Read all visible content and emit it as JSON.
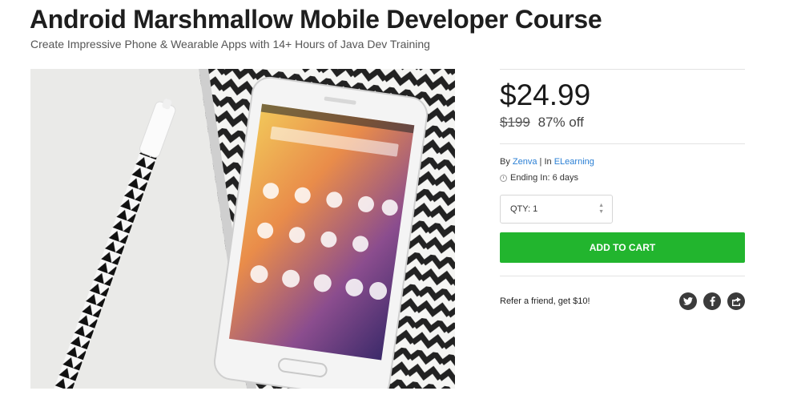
{
  "product": {
    "title": "Android Marshmallow Mobile Developer Course",
    "subtitle": "Create Impressive Phone & Wearable Apps with 14+ Hours of Java Dev Training"
  },
  "pricing": {
    "price": "$24.99",
    "original_price": "$199",
    "discount": "87% off"
  },
  "meta": {
    "by_label": "By",
    "vendor": "Zenva",
    "separator": "|",
    "in_label": "In",
    "category": "ELearning",
    "ending": "Ending In: 6 days"
  },
  "cart": {
    "qty_label": "QTY: 1",
    "add_to_cart": "ADD TO CART"
  },
  "referral": {
    "text": "Refer a friend, get $10!"
  },
  "social": {
    "icons": [
      "twitter-icon",
      "facebook-icon",
      "share-icon"
    ]
  },
  "colors": {
    "accent_green": "#22b52e",
    "link_blue": "#2a7fd4",
    "social_dark": "#3b3b3b"
  }
}
